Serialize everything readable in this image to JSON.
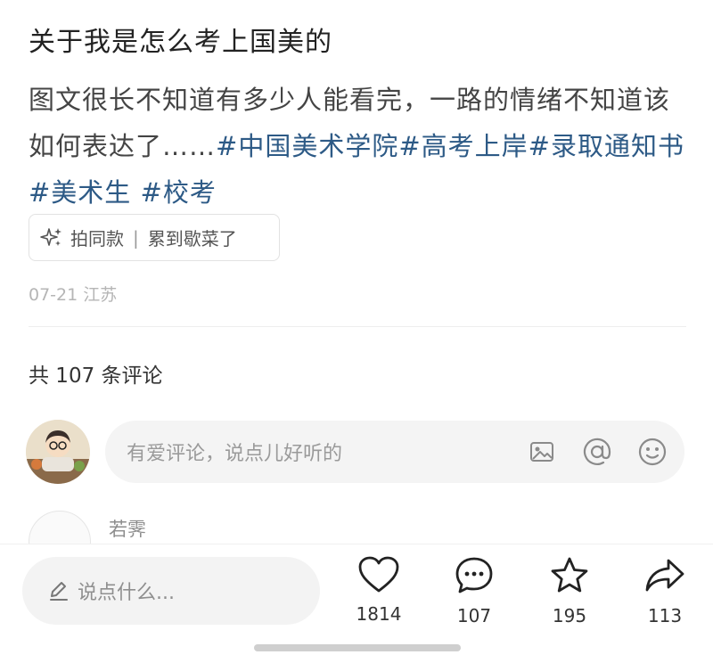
{
  "post": {
    "title": "关于我是怎么考上国美的",
    "desc_text": "图文很长不知道有多少人能看完，一路的情绪不知道该如何表达了……",
    "tags": [
      "#中国美术学院",
      "#高考上岸",
      "#录取通知书",
      " #美术生",
      " #校考"
    ],
    "same_style": {
      "label": "拍同款",
      "separator": "|",
      "author": "累到歇菜了"
    },
    "date_location": "07-21 江苏"
  },
  "comments": {
    "count_text": "共 107 条评论",
    "input_placeholder": "有爱评论，说点儿好听的",
    "first_commenter_name": "若霁"
  },
  "bottom_bar": {
    "say_placeholder": "说点什么...",
    "likes": "1814",
    "comments": "107",
    "favorites": "195",
    "shares": "113"
  }
}
